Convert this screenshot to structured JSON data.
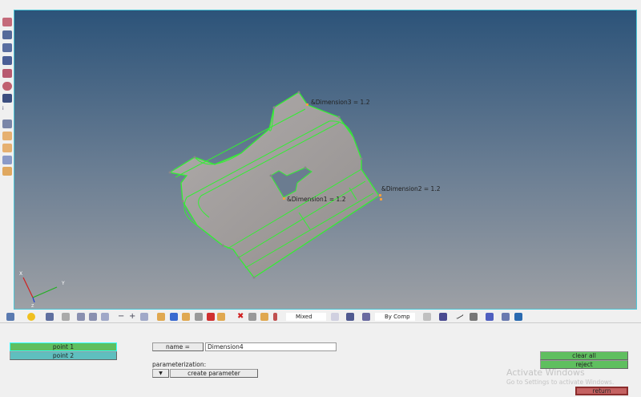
{
  "viewport": {
    "dimensions": [
      {
        "label": "&Dimension3 = 1.2"
      },
      {
        "label": "&Dimension2 = 1.2"
      },
      {
        "label": "&Dimension1 = 1.2"
      }
    ],
    "axes": {
      "x": "X",
      "y": "Y",
      "z": "Z"
    },
    "edge_color": "#33ee33",
    "surface_color": "#a39f9e"
  },
  "toolbar": {
    "display_mode": "Mixed",
    "color_mode": "By Comp"
  },
  "panel": {
    "point1": "point 1",
    "point2": "point 2",
    "name_label": "name =",
    "name_value": "Dimension4",
    "parameterization_label": "parameterization:",
    "dropdown_arrow": "▼",
    "create_parameter": "create parameter",
    "clear_all": "clear all",
    "reject": "reject",
    "return": "return"
  },
  "watermark": {
    "title": "Activate Windows",
    "subtitle": "Go to Settings to activate Windows."
  }
}
